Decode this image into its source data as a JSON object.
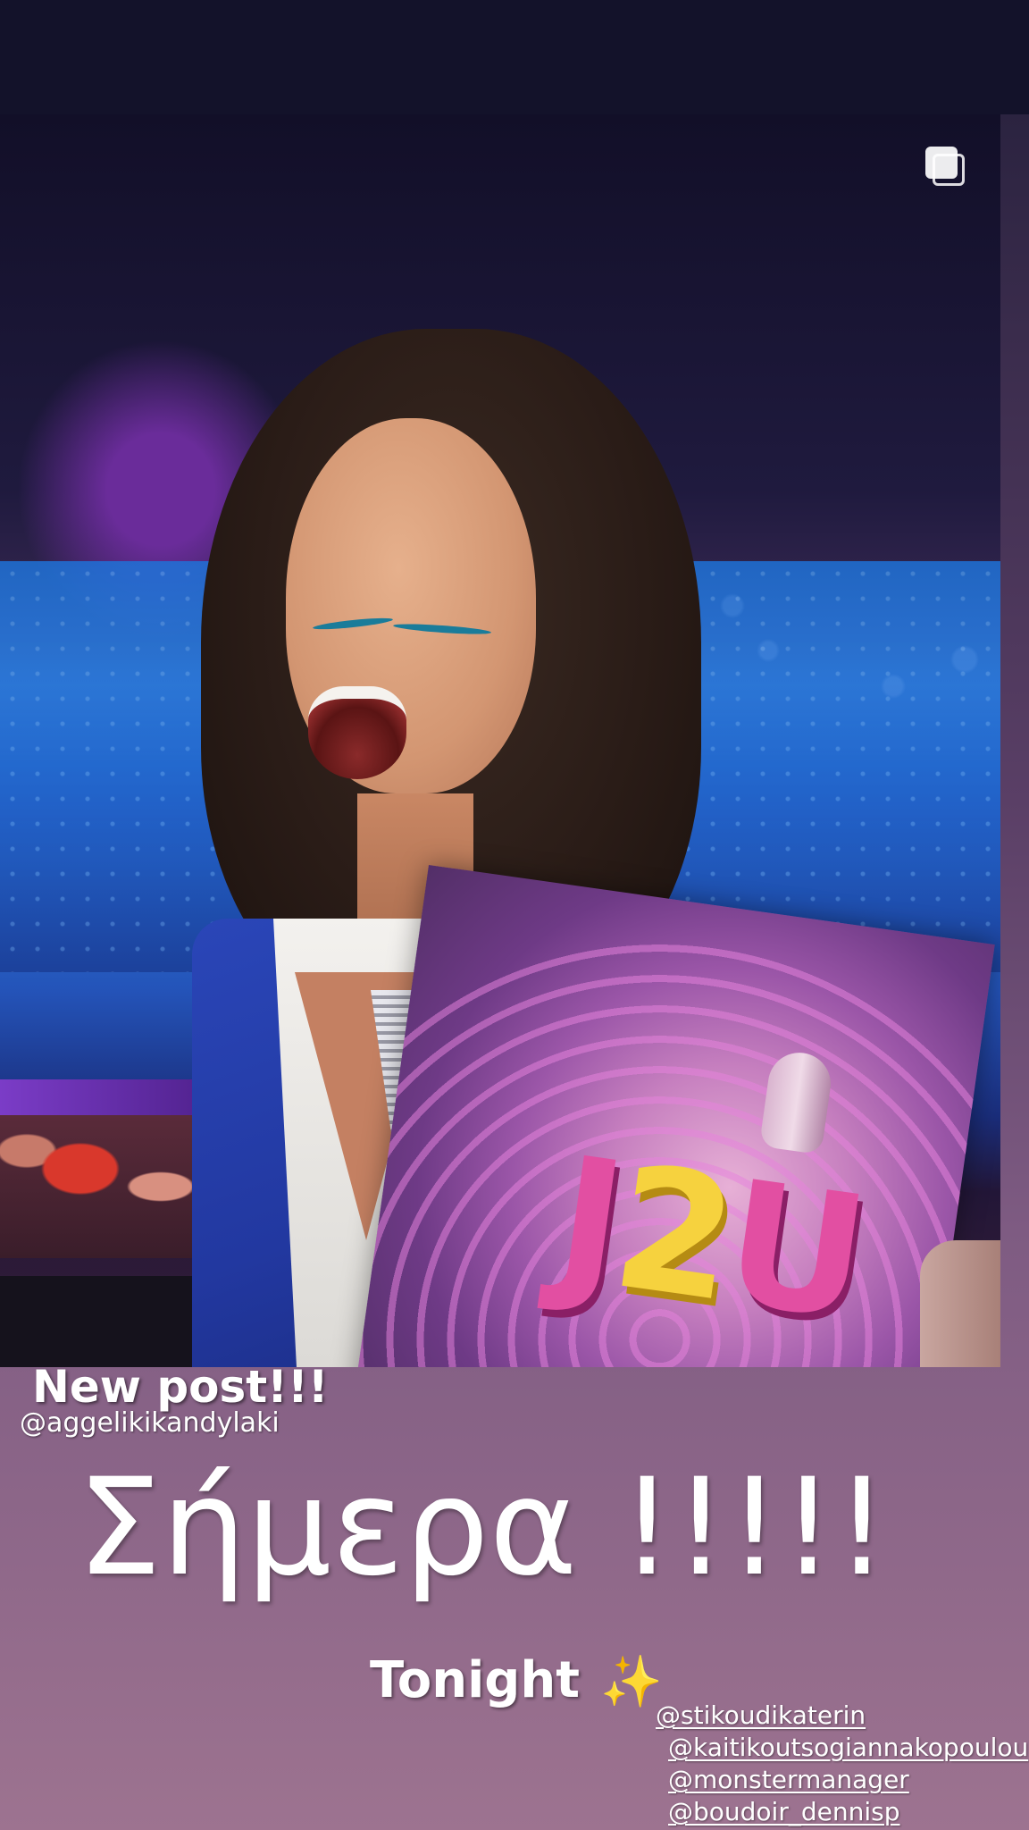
{
  "story": {
    "new_post_label": "New post!!!",
    "source_tag": "@aggelikikandylaki",
    "headline": "Σήμερα !!!!!",
    "subline": "Tonight",
    "subline_icon": "sparkles-icon",
    "mentions": [
      "@stikoudikaterin",
      "@kaitikoutsogiannakopoulou",
      "@monstermanager",
      "@boudoir_dennisp"
    ]
  },
  "photo": {
    "sign_text_left": "J",
    "sign_text_number": "2",
    "sign_text_right": "U",
    "multi_photo_icon": "multiple-photos-icon"
  },
  "colors": {
    "top_bar": "#13122a",
    "story_gradient_bottom": "#9d7390",
    "text": "#ffffff",
    "sparkles": "#f4c542"
  }
}
